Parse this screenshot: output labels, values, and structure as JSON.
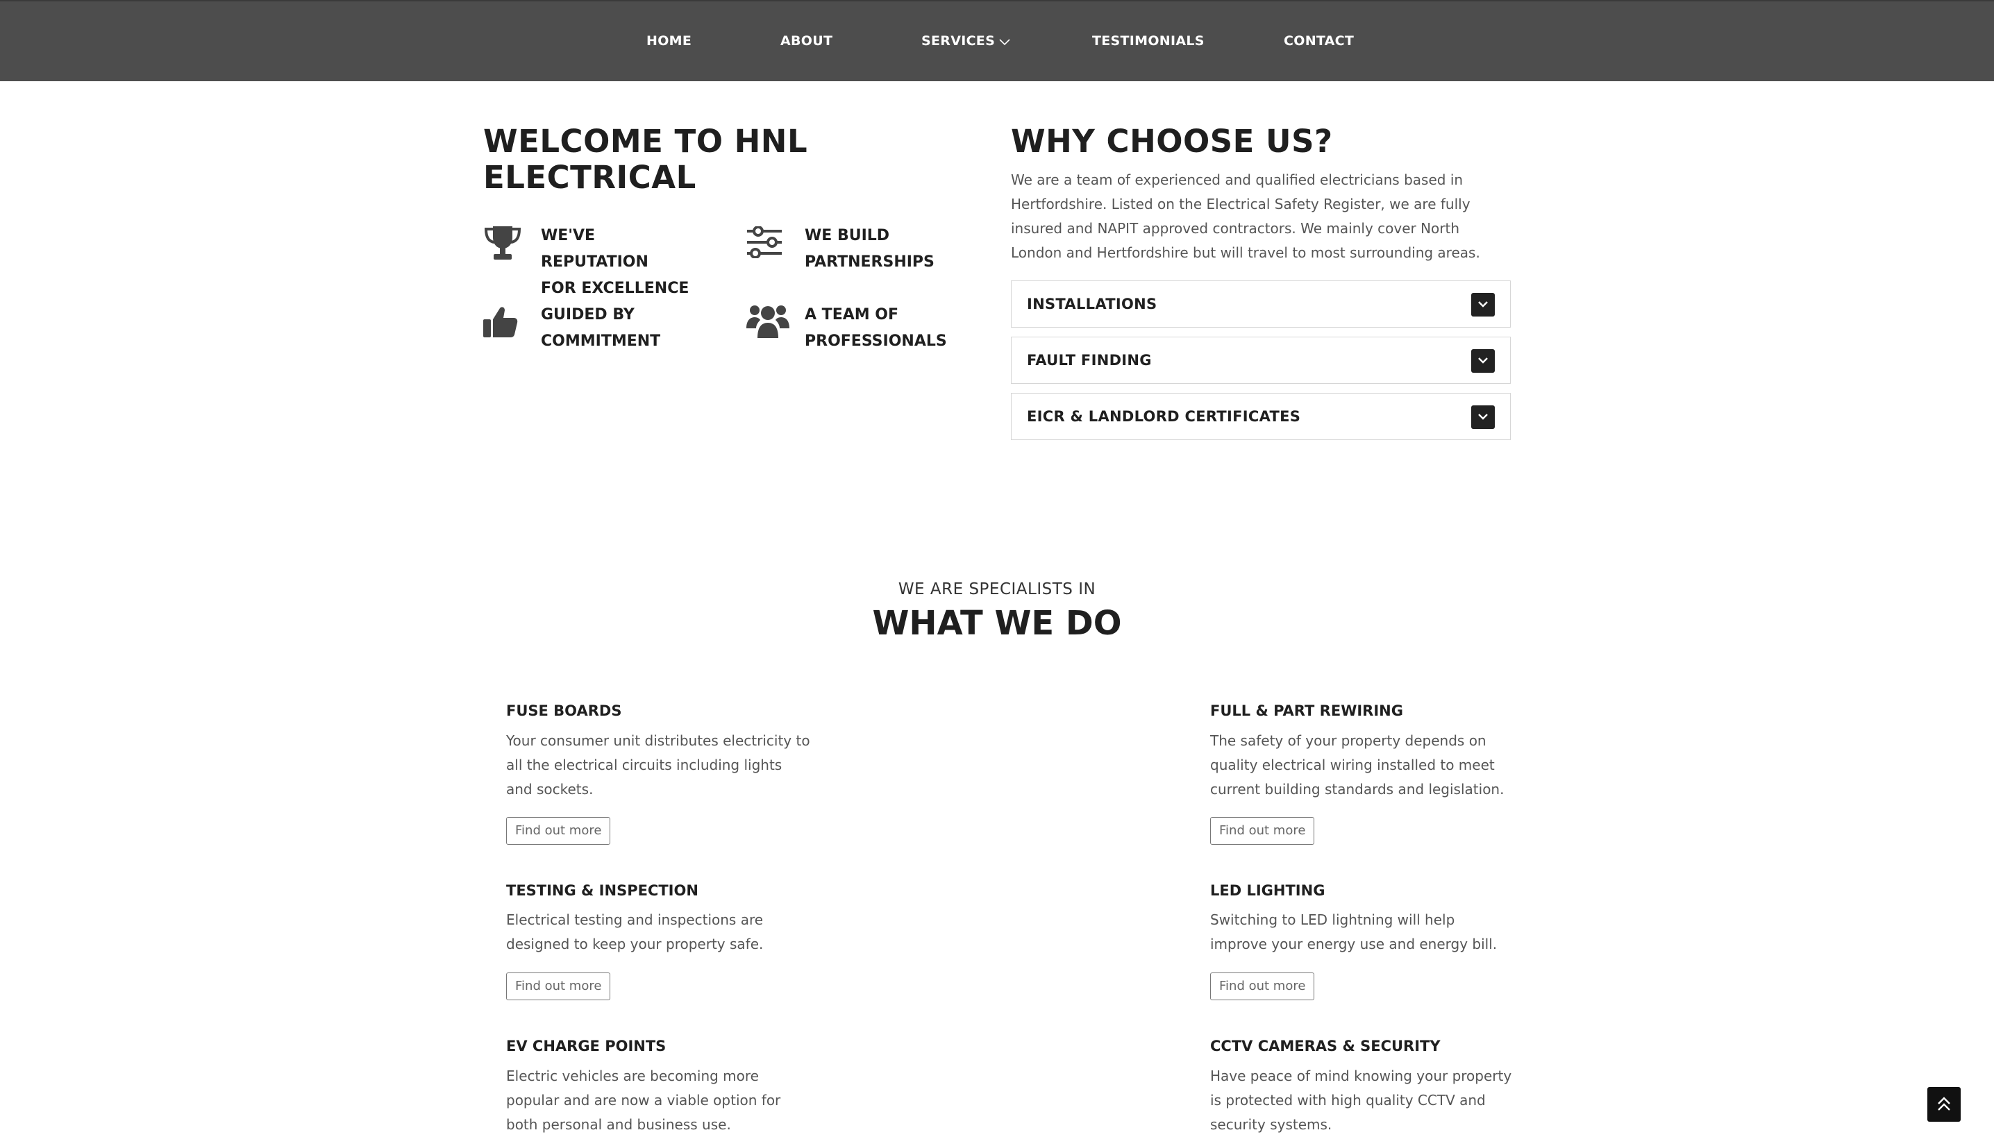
{
  "nav": {
    "items": [
      "HOME",
      "ABOUT",
      "SERVICES",
      "TESTIMONIALS",
      "CONTACT"
    ]
  },
  "welcome": {
    "title_line1": "WELCOME TO HNL",
    "title_line2": "ELECTRICAL",
    "features": [
      {
        "icon": "trophy-icon",
        "line1": "WE'VE REPUTATION",
        "line2": "FOR EXCELLENCE"
      },
      {
        "icon": "sliders-icon",
        "line1": "WE BUILD",
        "line2": "PARTNERSHIPS"
      },
      {
        "icon": "thumbs-up-icon",
        "line1": "GUIDED BY",
        "line2": "COMMITMENT"
      },
      {
        "icon": "users-icon",
        "line1": "A TEAM OF",
        "line2": "PROFESSIONALS"
      }
    ]
  },
  "why": {
    "title": "WHY CHOOSE US?",
    "text": "We are a team of experienced and qualified electricians based in Hertfordshire. Listed on the Electrical Safety Register, we are fully insured and NAPIT approved contractors. We mainly cover North London and Hertfordshire but will travel to most surrounding areas.",
    "accordion": [
      "INSTALLATIONS",
      "FAULT FINDING",
      "EICR & LANDLORD CERTIFICATES"
    ]
  },
  "services": {
    "kicker": "WE ARE SPECIALISTS IN",
    "title": "WHAT WE DO",
    "button_label": "Find out more",
    "items": [
      {
        "title": "FUSE BOARDS",
        "text": "Your consumer unit distributes electricity to all the electrical circuits including lights and sockets."
      },
      {
        "title": "FULL & PART REWIRING",
        "text": "The safety of your property depends on quality electrical wiring installed to meet current building standards and legislation."
      },
      {
        "title": "TESTING & INSPECTION",
        "text": "Electrical testing and inspections are designed to keep your property safe."
      },
      {
        "title": "LED LIGHTING",
        "text": "Switching to LED lightning will help improve your energy use and energy bill."
      },
      {
        "title": "EV CHARGE POINTS",
        "text": "Electric vehicles are becoming more popular and are now a viable option for both personal and business use."
      },
      {
        "title": "CCTV CAMERAS & SECURITY",
        "text": "Have peace of mind knowing your property is protected with high quality CCTV and security systems."
      }
    ]
  },
  "colors": {
    "nav_bg": "#4d4d4d",
    "text_dark": "#1f1f1f",
    "accent_dark": "#222222"
  }
}
